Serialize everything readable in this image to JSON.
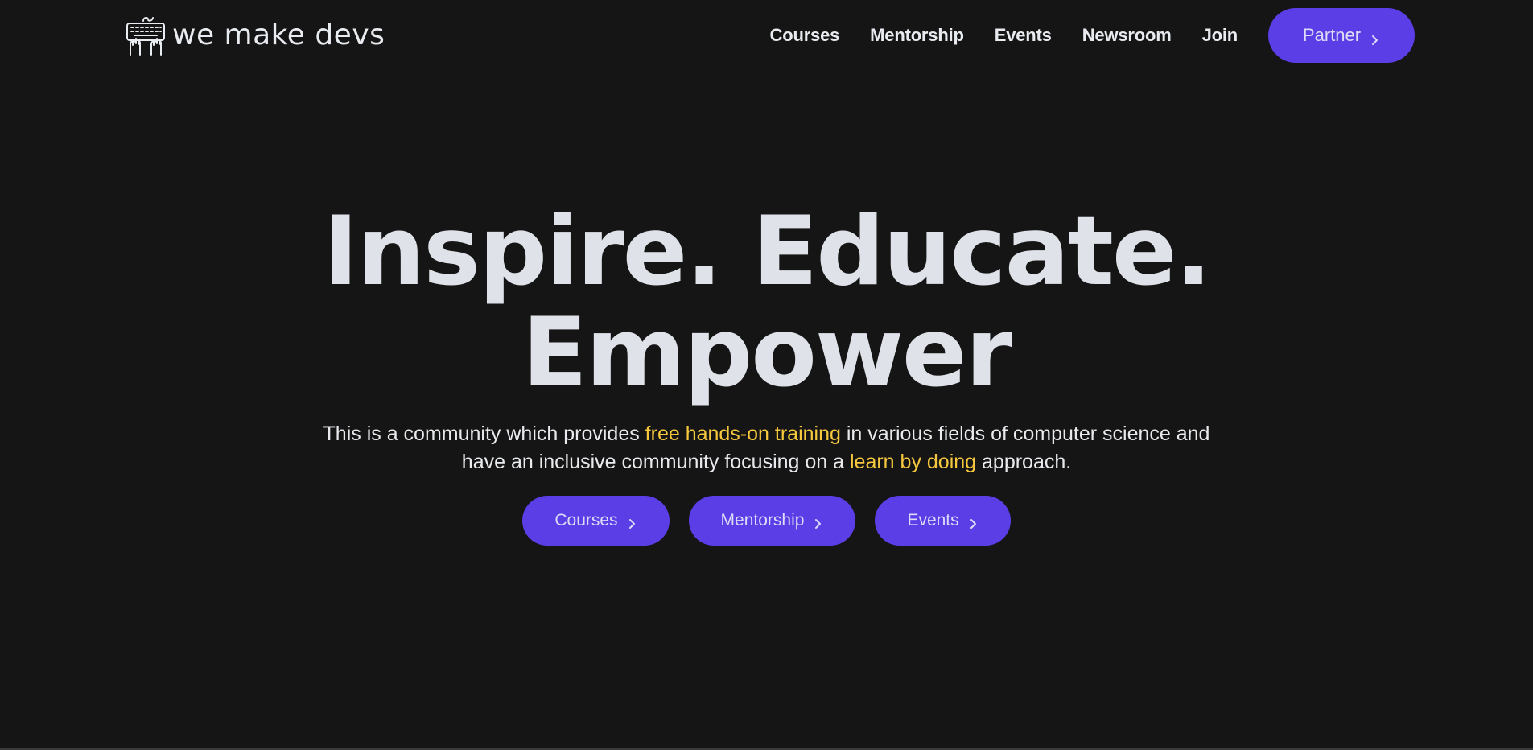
{
  "nav": {
    "logo_text": "we make devs",
    "links": [
      {
        "label": "Courses"
      },
      {
        "label": "Mentorship"
      },
      {
        "label": "Events"
      },
      {
        "label": "Newsroom"
      },
      {
        "label": "Join"
      }
    ],
    "partner_label": "Partner"
  },
  "hero": {
    "title_line1": "Inspire. Educate.",
    "title_line2": "Empower",
    "sub_part1": "This is a community which provides ",
    "sub_highlight1": "free hands-on training",
    "sub_part2": " in various fields of computer science and have an inclusive community focusing on a ",
    "sub_highlight2": "learn by doing",
    "sub_part3": " approach.",
    "buttons": [
      {
        "label": "Courses"
      },
      {
        "label": "Mentorship"
      },
      {
        "label": "Events"
      }
    ]
  },
  "colors": {
    "background": "#151515",
    "accent": "#5b3ee6",
    "highlight": "#f6c83d",
    "text": "#e2e6ec"
  },
  "icons": {
    "logo": "keyboard-hands-icon",
    "button_chevron": "chevron-right-icon"
  }
}
